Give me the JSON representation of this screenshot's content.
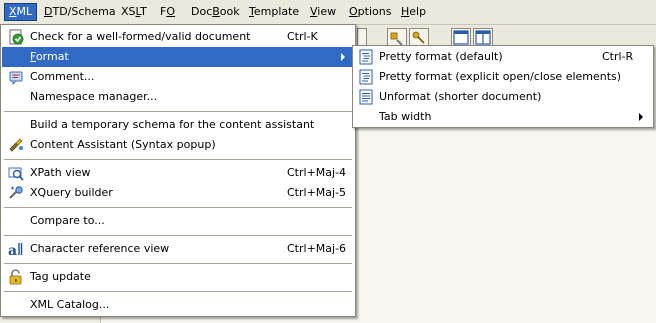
{
  "menubar": [
    {
      "label": "XML",
      "mnemonic": "X",
      "rest": "ML",
      "active": true
    },
    {
      "label": "DTD/Schema",
      "mnemonic": "D",
      "rest": "TD/Schema"
    },
    {
      "label": "XSLT",
      "pre": "XS",
      "mnemonic": "L",
      "rest": "T"
    },
    {
      "label": "FO",
      "pre": "F",
      "mnemonic": "O",
      "rest": ""
    },
    {
      "label": "DocBook",
      "pre": "Doc",
      "mnemonic": "B",
      "rest": "ook"
    },
    {
      "label": "Template",
      "mnemonic": "T",
      "rest": "emplate"
    },
    {
      "label": "View",
      "mnemonic": "V",
      "rest": "iew"
    },
    {
      "label": "Options",
      "mnemonic": "O",
      "rest": "ptions"
    },
    {
      "label": "Help",
      "mnemonic": "H",
      "rest": "elp"
    }
  ],
  "xml_menu": {
    "check": {
      "label": "Check for a well-formed/valid document",
      "shortcut": "Ctrl-K"
    },
    "format": {
      "label": "Format",
      "mnemonic": "F",
      "rest": "ormat"
    },
    "comment": {
      "label": "Comment..."
    },
    "namespace": {
      "label": "Namespace manager..."
    },
    "build_schema": {
      "label": "Build a temporary schema for the content assistant"
    },
    "content_assistant": {
      "label": "Content Assistant (Syntax popup)"
    },
    "xpath": {
      "label": "XPath view",
      "shortcut": "Ctrl+Maj-4"
    },
    "xquery": {
      "label": "XQuery builder",
      "shortcut": "Ctrl+Maj-5"
    },
    "compare": {
      "label": "Compare to..."
    },
    "charref": {
      "label": "Character reference view",
      "shortcut": "Ctrl+Maj-6"
    },
    "tag_update": {
      "label": "Tag update"
    },
    "catalog": {
      "label": "XML Catalog..."
    }
  },
  "format_submenu": {
    "pretty": {
      "label": "Pretty format (default)",
      "shortcut": "Ctrl-R"
    },
    "pretty_explicit": {
      "label": "Pretty format (explicit open/close elements)"
    },
    "unformat": {
      "label": "Unformat (shorter document)"
    },
    "tab_width": {
      "label": "Tab width"
    }
  },
  "colors": {
    "highlight": "#316ac5",
    "menu_bg": "#ffffff",
    "menubar_bg": "#ebe9de"
  }
}
